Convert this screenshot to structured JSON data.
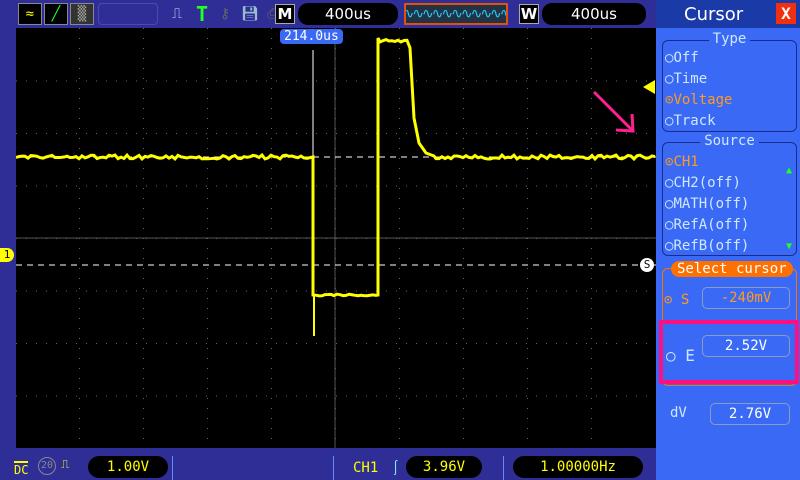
{
  "toolbar": {
    "m_label": "M",
    "timebase": "400us",
    "w_label": "W",
    "window": "400us"
  },
  "screen": {
    "trigger_position": "214.0us",
    "cursor_s_marker": "S",
    "ground_marker": "1"
  },
  "panel": {
    "title": "Cursor",
    "close": "X",
    "type_label": "Type",
    "types": [
      {
        "label": "Off",
        "selected": false
      },
      {
        "label": "Time",
        "selected": false
      },
      {
        "label": "Voltage",
        "selected": true
      },
      {
        "label": "Track",
        "selected": false
      }
    ],
    "source_label": "Source",
    "sources": [
      {
        "label": "CH1",
        "selected": true
      },
      {
        "label": "CH2(off)",
        "selected": false
      },
      {
        "label": "MATH(off)",
        "selected": false
      },
      {
        "label": "RefA(off)",
        "selected": false
      },
      {
        "label": "RefB(off)",
        "selected": false
      }
    ],
    "select_label": "Select cursor",
    "s_label": "S",
    "s_value": "-240mV",
    "e_label": "E",
    "e_value": "2.52V",
    "dv_label": "dV",
    "dv_value": "2.76V"
  },
  "bottom": {
    "coupling": "DC",
    "bw_limit": "20",
    "ch1_scale": "1.00V",
    "trigger_source": "CH1",
    "trigger_level": "3.96V",
    "frequency": "1.00000Hz"
  },
  "colors": {
    "trace": "#ffff00",
    "accent": "#ff7000",
    "highlight": "#ff1080",
    "panel": "#3a6af5"
  }
}
